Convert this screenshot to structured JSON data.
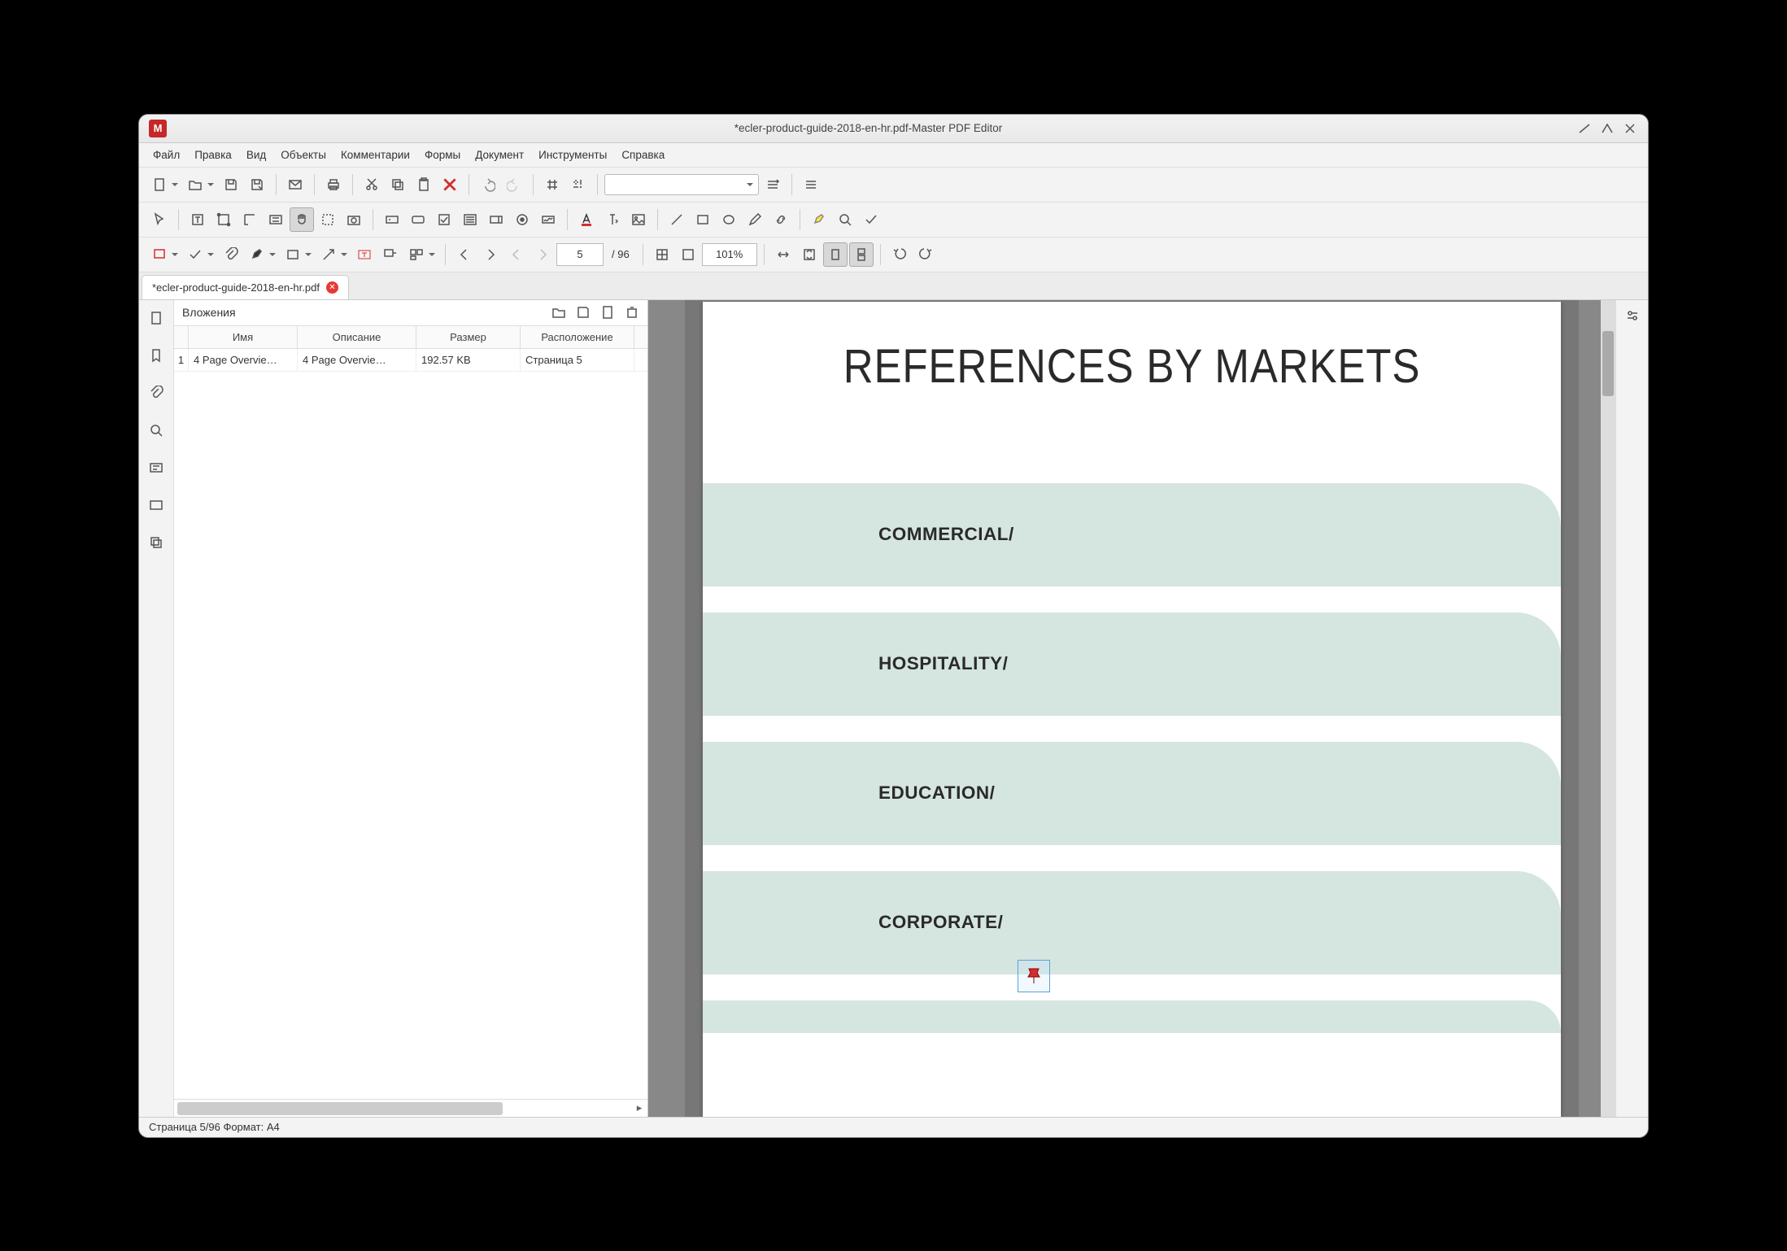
{
  "window": {
    "title": "*ecler-product-guide-2018-en-hr.pdf-Master PDF Editor"
  },
  "menu": [
    "Файл",
    "Правка",
    "Вид",
    "Объекты",
    "Комментарии",
    "Формы",
    "Документ",
    "Инструменты",
    "Справка"
  ],
  "tab": {
    "label": "*ecler-product-guide-2018-en-hr.pdf"
  },
  "nav": {
    "page": "5",
    "total": "/ 96",
    "zoom": "101%"
  },
  "panel": {
    "title": "Вложения",
    "headers": [
      "",
      "Имя",
      "Описание",
      "Размер",
      "Расположение"
    ],
    "rows": [
      {
        "idx": "1",
        "name": "4 Page Overvie…",
        "desc": "4 Page Overvie…",
        "size": "192.57 KB",
        "loc": "Страница 5"
      }
    ]
  },
  "doc": {
    "heading": "REFERENCES BY MARKETS",
    "blocks": [
      "COMMERCIAL/",
      "HOSPITALITY/",
      "EDUCATION/",
      "CORPORATE/"
    ]
  },
  "status": "Страница 5/96 Формат: A4"
}
